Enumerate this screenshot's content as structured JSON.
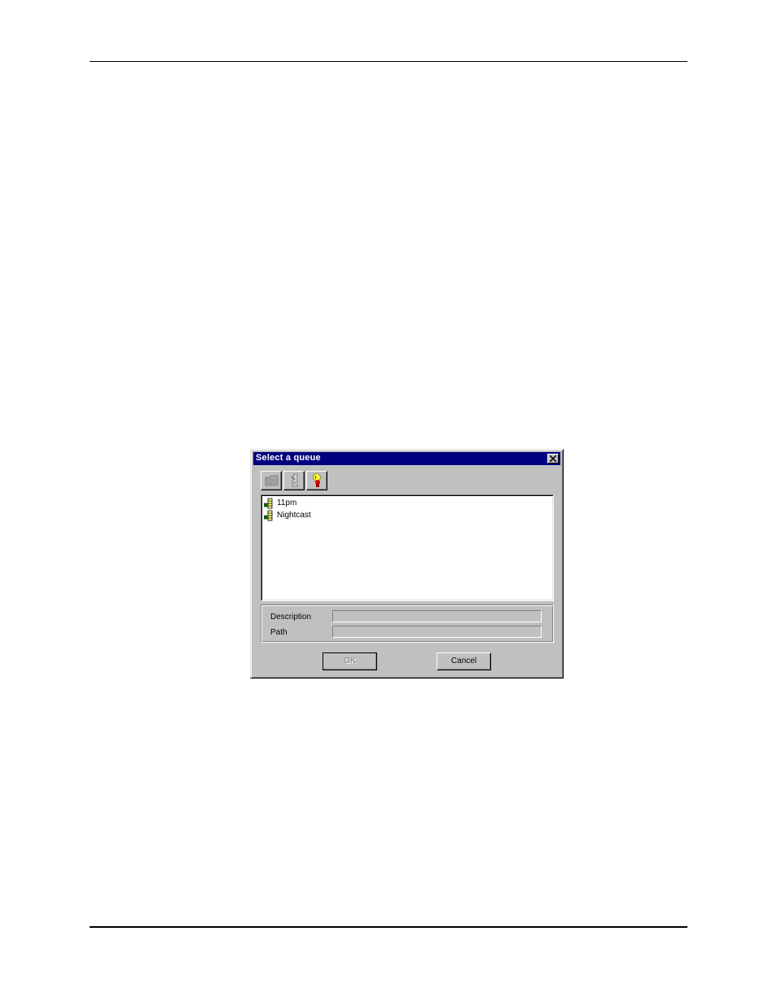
{
  "dialog": {
    "title": "Select a queue",
    "close_label": "×",
    "toolbar": {
      "buttons": [
        {
          "icon": "folder-icon",
          "enabled": false
        },
        {
          "icon": "queue-icon",
          "enabled": false
        },
        {
          "icon": "lightbulb-icon",
          "enabled": true
        }
      ]
    },
    "queues": [
      {
        "label": "11pm",
        "icon": "queue-icon"
      },
      {
        "label": "Nightcast",
        "icon": "queue-icon"
      }
    ],
    "info": {
      "description_label": "Description",
      "description_value": "",
      "path_label": "Path",
      "path_value": ""
    },
    "buttons": {
      "ok_label": "OK",
      "cancel_label": "Cancel"
    }
  },
  "colors": {
    "titlebar": "#000080",
    "dialog_face": "#c0c0c0",
    "listbox_bg": "#ffffff"
  }
}
